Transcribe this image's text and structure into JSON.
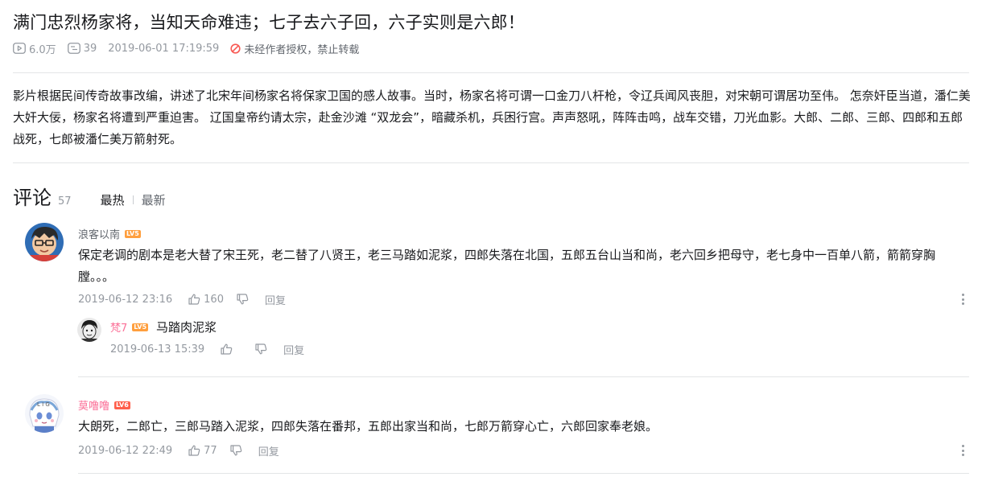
{
  "video": {
    "title": "满门忠烈杨家将，当知天命难违；七子去六子回，六子实则是六郎！",
    "views": "6.0万",
    "danmaku": "39",
    "date": "2019-06-01 17:19:59",
    "copyright": "未经作者授权，禁止转载",
    "description": "影片根据民间传奇故事改编，讲述了北宋年间杨家名将保家卫国的感人故事。当时，杨家名将可谓一口金刀八杆枪，令辽兵闻风丧胆，对宋朝可谓居功至伟。 怎奈奸臣当道，潘仁美大奸大佞，杨家名将遭到严重迫害。 辽国皇帝约请太宗，赴金沙滩 “双龙会”，暗藏杀机，兵困行宫。声声怒吼，阵阵击鸣，战车交错，刀光血影。大郎、二郎、三郎、四郎和五郎战死，七郎被潘仁美万箭射死。"
  },
  "comments_header": {
    "title": "评论",
    "count": "57",
    "sort_hot": "最热",
    "sort_new": "最新"
  },
  "comments": [
    {
      "user": "浪客以南",
      "level": "LV5",
      "text": "保定老调的剧本是老大替了宋王死，老二替了八贤王，老三马踏如泥浆，四郎失落在北国，五郎五台山当和尚，老六回乡把母守，老七身中一百单八箭，箭箭穿胸膛。。。",
      "time": "2019-06-12 23:16",
      "likes": "160",
      "reply_label": "回复",
      "sub_reply": {
        "user": "梵7",
        "level": "LV5",
        "text": "马踏肉泥浆",
        "time": "2019-06-13 15:39",
        "reply_label": "回复"
      }
    },
    {
      "user": "莫噜噜",
      "level": "LV6",
      "text": "大朗死，二郎亡，三郎马踏入泥浆，四郎失落在番邦，五郎出家当和尚，七郎万箭穿心亡，六郎回家奉老娘。",
      "time": "2019-06-12 22:49",
      "likes": "77",
      "reply_label": "回复"
    }
  ],
  "icons": {
    "views": "play-count-icon",
    "danmaku": "danmaku-icon",
    "copyright": "no-reprint-icon",
    "like": "thumb-up-icon",
    "dislike": "thumb-down-icon",
    "more": "more-vertical-icon"
  },
  "colors": {
    "primary_text": "#18191c",
    "secondary_text": "#9499a0",
    "warning": "#f85a54",
    "vip_name": "#fb7299",
    "level5": "#ff9f3e",
    "level6": "#ff5f4b"
  }
}
